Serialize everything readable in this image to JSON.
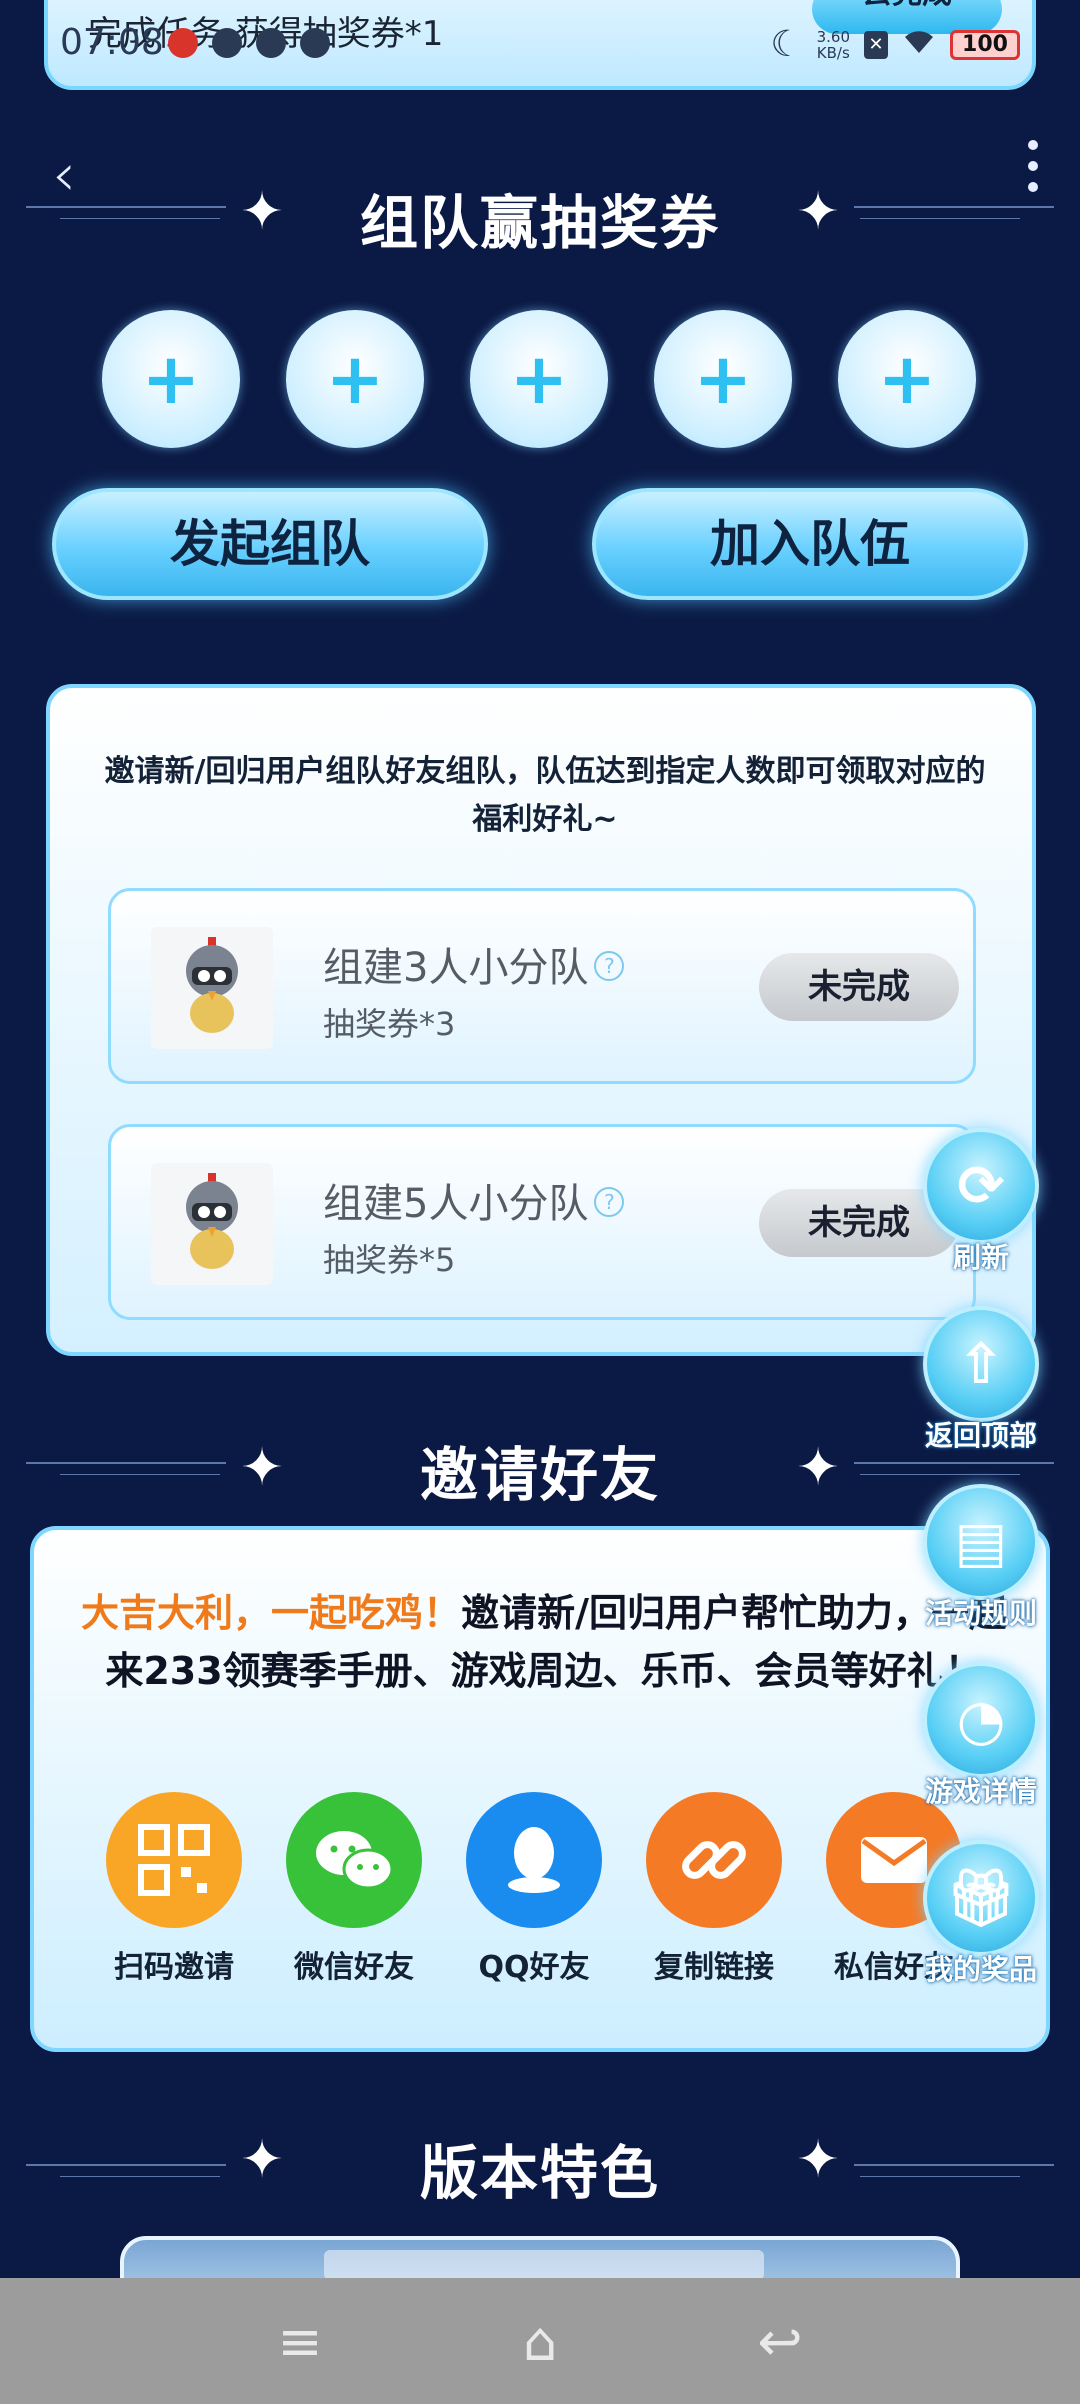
{
  "top_task": {
    "text": "完成任务,获得抽奖券*1",
    "button": "去完成"
  },
  "status_bar": {
    "time": "07:08",
    "speed_value": "3.60",
    "speed_unit": "KB/s",
    "battery": "100"
  },
  "team_section": {
    "title": "组队赢抽奖券",
    "start_team": "发起组队",
    "join_team": "加入队伍",
    "description": "邀请新/回归用户组队好友组队，队伍达到指定人数即可领取对应的福利好礼~",
    "tasks": [
      {
        "title": "组建3人小分队",
        "reward": "抽奖券*3",
        "status": "未完成"
      },
      {
        "title": "组建5人小分队",
        "reward": "抽奖券*5",
        "status": "未完成"
      }
    ]
  },
  "invite_section": {
    "title": "邀请好友",
    "highlight": "大吉大利，一起吃鸡！",
    "text": "邀请新/回归用户帮忙助力，一起来233领赛季手册、游戏周边、乐币、会员等好礼！",
    "share_options": [
      {
        "label": "扫码邀请",
        "icon": "qr-code-icon",
        "color": "#f9a526"
      },
      {
        "label": "微信好友",
        "icon": "wechat-icon",
        "color": "#37c23a"
      },
      {
        "label": "QQ好友",
        "icon": "qq-icon",
        "color": "#1a8cf0"
      },
      {
        "label": "复制链接",
        "icon": "link-icon",
        "color": "#f57a26"
      },
      {
        "label": "私信好友",
        "icon": "mail-icon",
        "color": "#f57a26"
      }
    ]
  },
  "side_buttons": [
    {
      "label": "刷新",
      "icon": "refresh-icon"
    },
    {
      "label": "返回顶部",
      "icon": "arrow-up-icon"
    },
    {
      "label": "活动规则",
      "icon": "document-icon"
    },
    {
      "label": "游戏详情",
      "icon": "game-icon"
    },
    {
      "label": "我的奖品",
      "icon": "gift-icon"
    }
  ],
  "feature_section": {
    "title": "版本特色"
  }
}
